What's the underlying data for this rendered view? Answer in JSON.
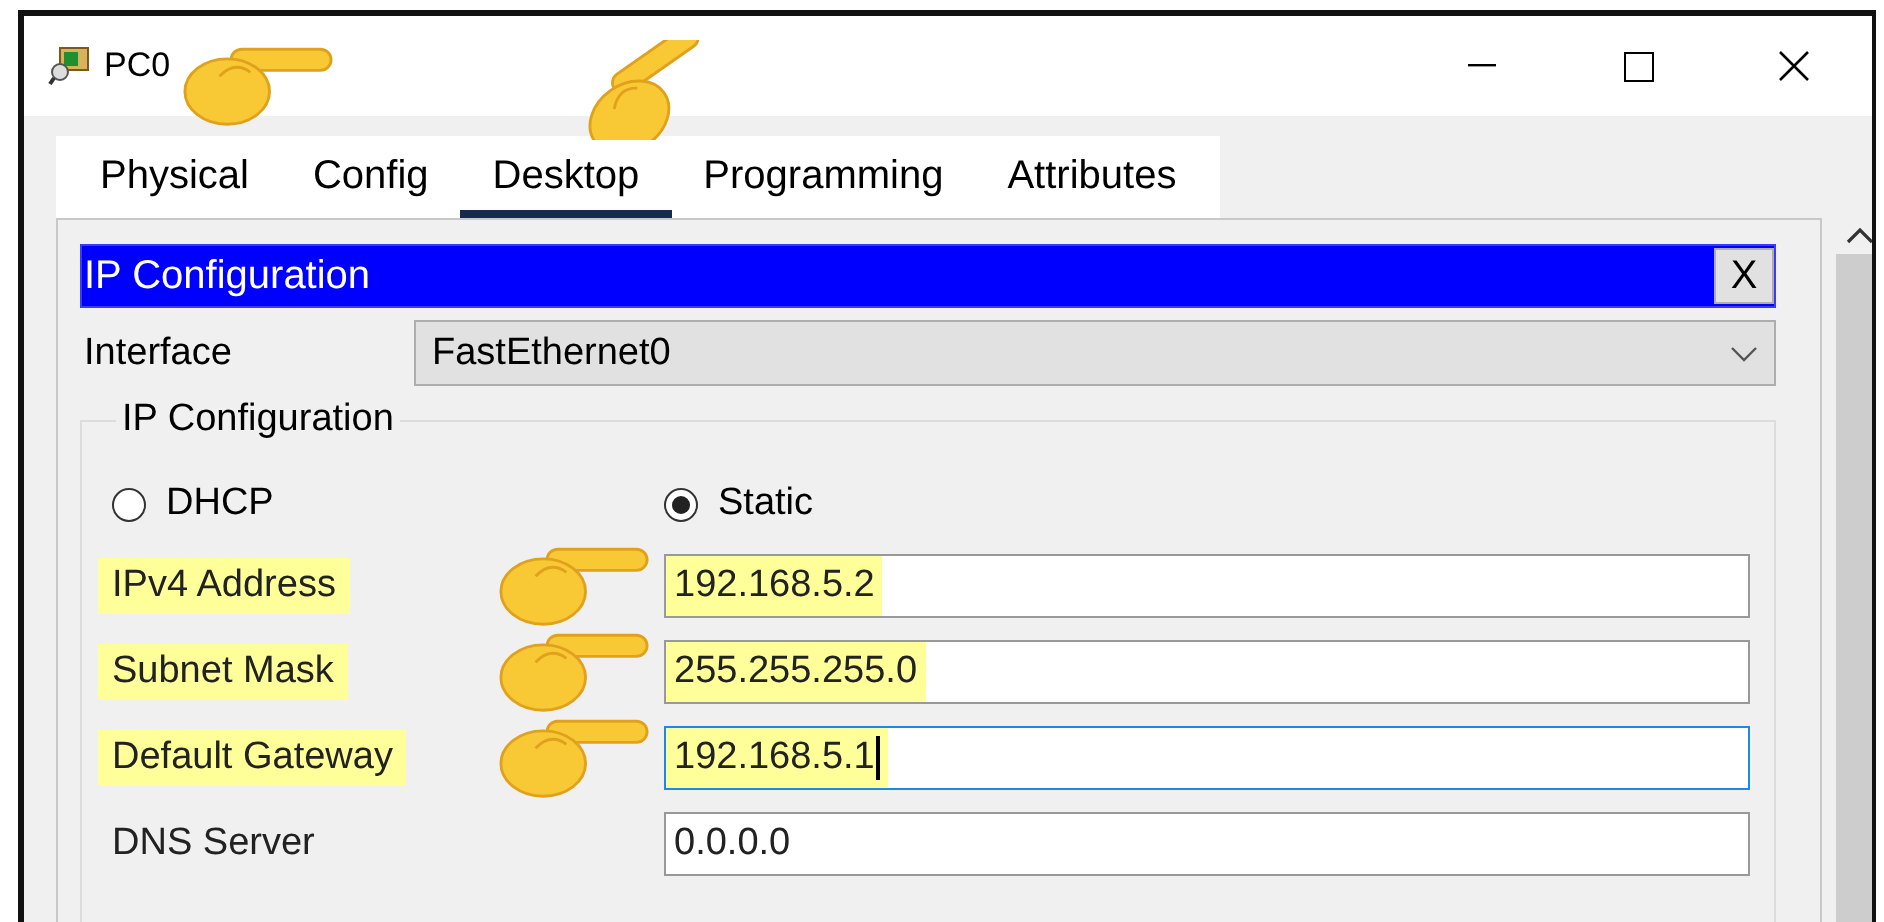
{
  "window": {
    "title": "PC0",
    "pointed": true
  },
  "tabs": [
    {
      "label": "Physical",
      "selected": false,
      "pointed": false
    },
    {
      "label": "Config",
      "selected": false,
      "pointed": false
    },
    {
      "label": "Desktop",
      "selected": true,
      "pointed": true
    },
    {
      "label": "Programming",
      "selected": false,
      "pointed": false
    },
    {
      "label": "Attributes",
      "selected": false,
      "pointed": false
    }
  ],
  "panel": {
    "title": "IP Configuration",
    "close_label": "X"
  },
  "interface": {
    "label": "Interface",
    "value": "FastEthernet0"
  },
  "group": {
    "legend": "IP Configuration",
    "modes": [
      {
        "label": "DHCP",
        "selected": false
      },
      {
        "label": "Static",
        "selected": true
      }
    ],
    "fields": [
      {
        "label": "IPv4 Address",
        "value": "192.168.5.2",
        "highlighted": true,
        "focused": false,
        "pointed": true
      },
      {
        "label": "Subnet Mask",
        "value": "255.255.255.0",
        "highlighted": true,
        "focused": false,
        "pointed": true
      },
      {
        "label": "Default Gateway",
        "value": "192.168.5.1",
        "highlighted": true,
        "focused": true,
        "pointed": true
      },
      {
        "label": "DNS Server",
        "value": "0.0.0.0",
        "highlighted": false,
        "focused": false,
        "pointed": false
      }
    ]
  }
}
